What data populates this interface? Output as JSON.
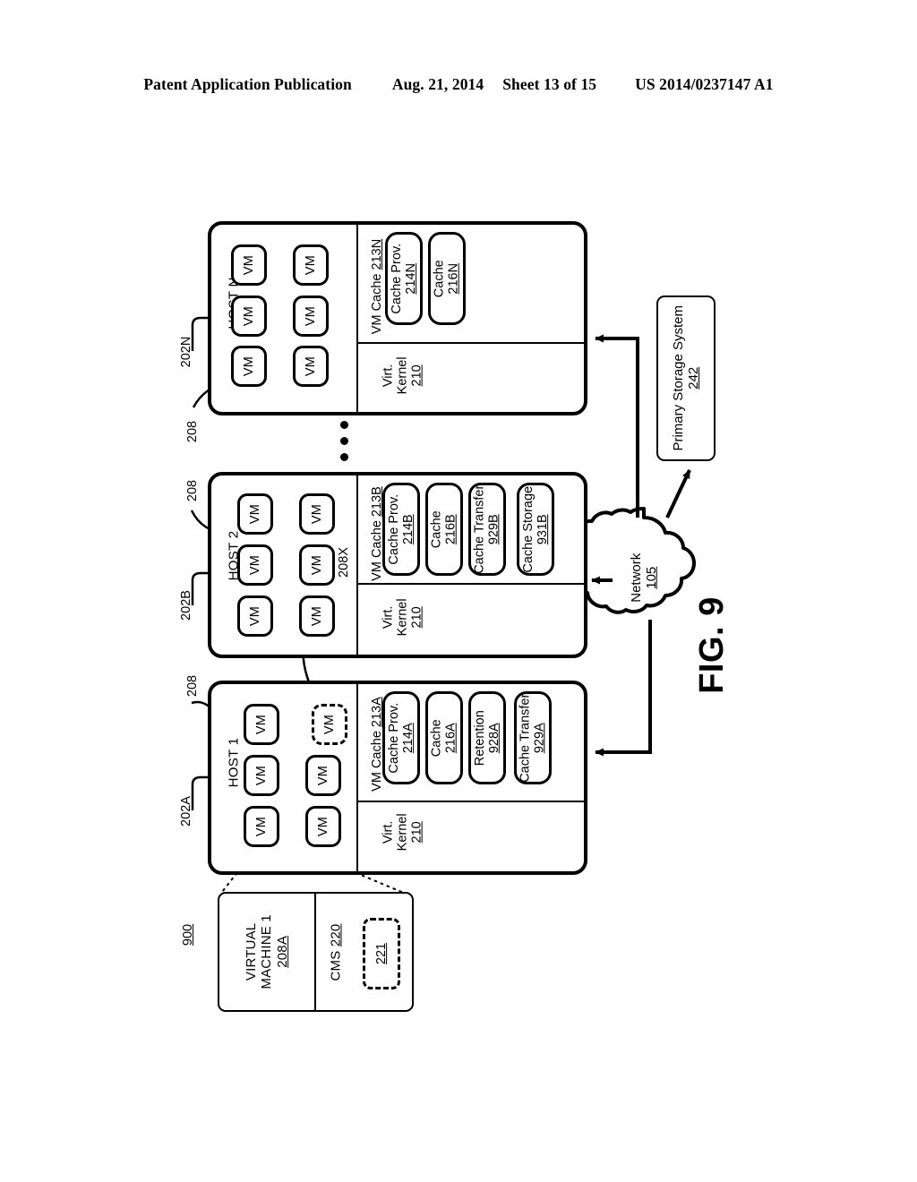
{
  "header": {
    "publication": "Patent Application Publication",
    "date": "Aug. 21, 2014",
    "sheet": "Sheet 13 of 15",
    "patent_number": "US 2014/0237147 A1"
  },
  "figure": {
    "label": "FIG. 9",
    "system_ref": "900"
  },
  "hosts": [
    {
      "id": "host-n",
      "title": "HOST N",
      "host_ref": "202N",
      "vm_ref": "208",
      "vm_label": "VM",
      "vm_count": 6,
      "cache_title_text": "VM Cache ",
      "cache_title_ref": "213N",
      "modules": [
        {
          "name": "Cache Prov.",
          "ref": "214N"
        },
        {
          "name": "Cache",
          "ref": "216N"
        }
      ],
      "kernel": {
        "line1": "Virt.",
        "line2": "Kernel",
        "ref": "210"
      }
    },
    {
      "id": "host-2",
      "title": "HOST 2",
      "host_ref": "202B",
      "vm_ref": "208",
      "vm_label": "VM",
      "vm_count": 6,
      "migrated_vm_ref": "208X",
      "cache_title_text": "VM Cache ",
      "cache_title_ref": "213B",
      "modules": [
        {
          "name": "Cache Prov.",
          "ref": "214B"
        },
        {
          "name": "Cache",
          "ref": "216B"
        },
        {
          "name": "Cache Transfer",
          "ref": "929B"
        },
        {
          "name": "Cache Storage",
          "ref": "931B"
        }
      ],
      "kernel": {
        "line1": "Virt.",
        "line2": "Kernel",
        "ref": "210"
      }
    },
    {
      "id": "host-1",
      "title": "HOST 1",
      "host_ref": "202A",
      "vm_ref": "208",
      "vm_label": "VM",
      "vm_count": 6,
      "cache_title_text": "VM Cache ",
      "cache_title_ref": "213A",
      "modules": [
        {
          "name": "Cache Prov.",
          "ref": "214A"
        },
        {
          "name": "Cache",
          "ref": "216A"
        },
        {
          "name": "Retention",
          "ref": "928A"
        },
        {
          "name": "Cache Transfer",
          "ref": "929A"
        }
      ],
      "kernel": {
        "line1": "Virt.",
        "line2": "Kernel",
        "ref": "210"
      }
    }
  ],
  "network": {
    "name": "Network",
    "ref": "105"
  },
  "primary_storage": {
    "line1": "Primary Storage System",
    "ref": "242"
  },
  "detail_callout": {
    "vm_line1": "VIRTUAL",
    "vm_line2": "MACHINE 1",
    "vm_ref": "208A",
    "cms_label": "CMS ",
    "cms_ref": "220",
    "inner_ref": "221"
  }
}
